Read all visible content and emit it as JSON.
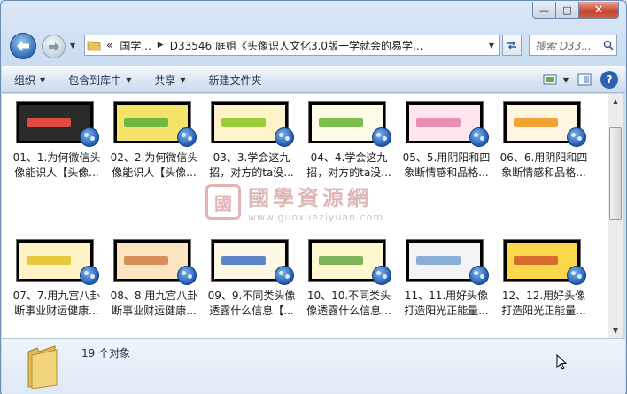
{
  "window": {
    "caption_buttons": {
      "minimize": "—",
      "maximize": "□",
      "close": "✕"
    }
  },
  "nav": {
    "back_icon": "back-arrow-icon",
    "forward_icon": "forward-arrow-icon",
    "address": {
      "overflow": "«",
      "segments": [
        "国学...",
        "D33546 庭姐《头像识人文化3.0版一学就会的易学..."
      ]
    },
    "search_placeholder": "搜索 D33..."
  },
  "toolbar": {
    "organize": "组织",
    "include_in_library": "包含到库中",
    "share": "共享",
    "new_folder": "新建文件夹"
  },
  "watermark": {
    "seal": "國",
    "title": "國學資源網",
    "url": "www.guoxueziyuan.com"
  },
  "items": [
    {
      "label": "01、1.为何微信头像能识人【头像...",
      "slide_color": "#2a2a2a",
      "accent": "#e04a3f"
    },
    {
      "label": "02、2.为何微信头像能识人【头像...",
      "slide_color": "#f3e36a",
      "accent": "#72b840"
    },
    {
      "label": "03、3.学会这九招，对方的ta没...",
      "slide_color": "#fff4c9",
      "accent": "#9ccc3a"
    },
    {
      "label": "04、4.学会这九招，对方的ta没...",
      "slide_color": "#fffbe9",
      "accent": "#7cbf4a"
    },
    {
      "label": "05、5.用阴阳和四象断情感和品格...",
      "slide_color": "#fde6ef",
      "accent": "#e88fb2"
    },
    {
      "label": "06、6.用阴阳和四象断情感和品格...",
      "slide_color": "#fef6e2",
      "accent": "#f0a332"
    },
    {
      "label": "07、7.用九宫八卦断事业财运健康...",
      "slide_color": "#fff2c4",
      "accent": "#e8c83a"
    },
    {
      "label": "08、8.用九宫八卦断事业财运健康...",
      "slide_color": "#fbe5c0",
      "accent": "#d98e5a"
    },
    {
      "label": "09、9.不同类头像透露什么信息【...",
      "slide_color": "#fdf8e4",
      "accent": "#5b86c9"
    },
    {
      "label": "10、10.不同类头像透露什么信息...",
      "slide_color": "#fff7cf",
      "accent": "#7ab35a"
    },
    {
      "label": "11、11.用好头像打造阳光正能量...",
      "slide_color": "#f4f4f4",
      "accent": "#8aaed6"
    },
    {
      "label": "12、12.用好头像打造阳光正能量...",
      "slide_color": "#fbd84a",
      "accent": "#d96b2c"
    }
  ],
  "details": {
    "count_text": "19 个对象"
  }
}
